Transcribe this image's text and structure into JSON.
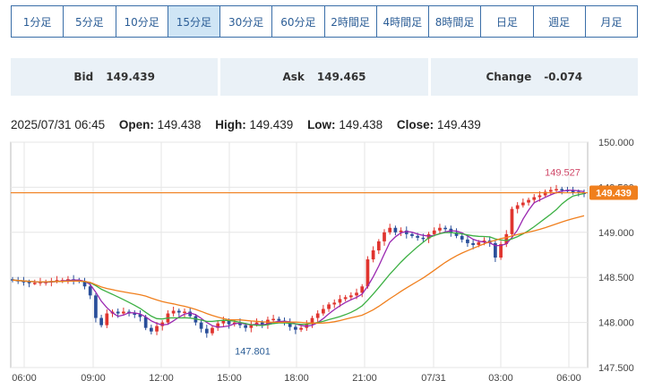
{
  "tabs": [
    "1分足",
    "5分足",
    "10分足",
    "15分足",
    "30分足",
    "60分足",
    "2時間足",
    "4時間足",
    "8時間足",
    "日足",
    "週足",
    "月足"
  ],
  "active_tab": "15分足",
  "quotes": {
    "bid_label": "Bid",
    "bid_value": "149.439",
    "ask_label": "Ask",
    "ask_value": "149.465",
    "change_label": "Change",
    "change_value": "-0.074"
  },
  "ohlc": {
    "datetime": "2025/07/31 06:45",
    "open_label": "Open:",
    "open": "149.438",
    "high_label": "High:",
    "high": "149.439",
    "low_label": "Low:",
    "low": "149.438",
    "close_label": "Close:",
    "close": "149.439"
  },
  "colors": {
    "up": "#e0342e",
    "down": "#2a4f9a",
    "ma_short": "#9a27b0",
    "ma_mid": "#3cb043",
    "ma_long": "#f07f1d",
    "price_line": "#f07f1d"
  },
  "chart_data": {
    "type": "candlestick",
    "ylim": [
      147.5,
      150.0
    ],
    "y_ticks": [
      "150.000",
      "149.500",
      "149.000",
      "148.500",
      "148.000",
      "147.500"
    ],
    "x_ticks": [
      "06:00",
      "09:00",
      "12:00",
      "15:00",
      "18:00",
      "21:00",
      "07/31",
      "03:00",
      "06:00"
    ],
    "current_price_label": "149.439",
    "current_price": 149.439,
    "annotations": [
      {
        "text": "149.527",
        "value": 149.527
      },
      {
        "text": "147.801",
        "value": 147.801
      }
    ],
    "closes": [
      148.47,
      148.46,
      148.45,
      148.44,
      148.44,
      148.45,
      148.45,
      148.46,
      148.47,
      148.47,
      148.48,
      148.47,
      148.46,
      148.4,
      148.3,
      148.05,
      147.97,
      148.1,
      148.12,
      148.1,
      148.12,
      148.1,
      148.09,
      148.06,
      147.94,
      147.9,
      147.96,
      148.0,
      148.1,
      148.13,
      148.11,
      148.12,
      148.07,
      148.0,
      147.93,
      147.88,
      147.94,
      147.99,
      148.02,
      147.98,
      148.0,
      147.97,
      147.94,
      147.98,
      148.0,
      147.97,
      148.03,
      148.04,
      148.02,
      148.0,
      147.95,
      147.92,
      147.94,
      147.98,
      148.05,
      148.1,
      148.15,
      148.2,
      148.22,
      148.26,
      148.28,
      148.3,
      148.33,
      148.4,
      148.7,
      148.8,
      148.9,
      149.0,
      149.05,
      149.0,
      149.02,
      148.98,
      148.96,
      148.94,
      148.93,
      148.98,
      149.02,
      149.05,
      149.04,
      149.0,
      148.96,
      148.92,
      148.88,
      148.86,
      148.89,
      148.91,
      148.88,
      148.72,
      148.87,
      148.98,
      149.26,
      149.3,
      149.33,
      149.36,
      149.39,
      149.41,
      149.45,
      149.47,
      149.48,
      149.47,
      149.46,
      149.45,
      149.44,
      149.439
    ]
  }
}
